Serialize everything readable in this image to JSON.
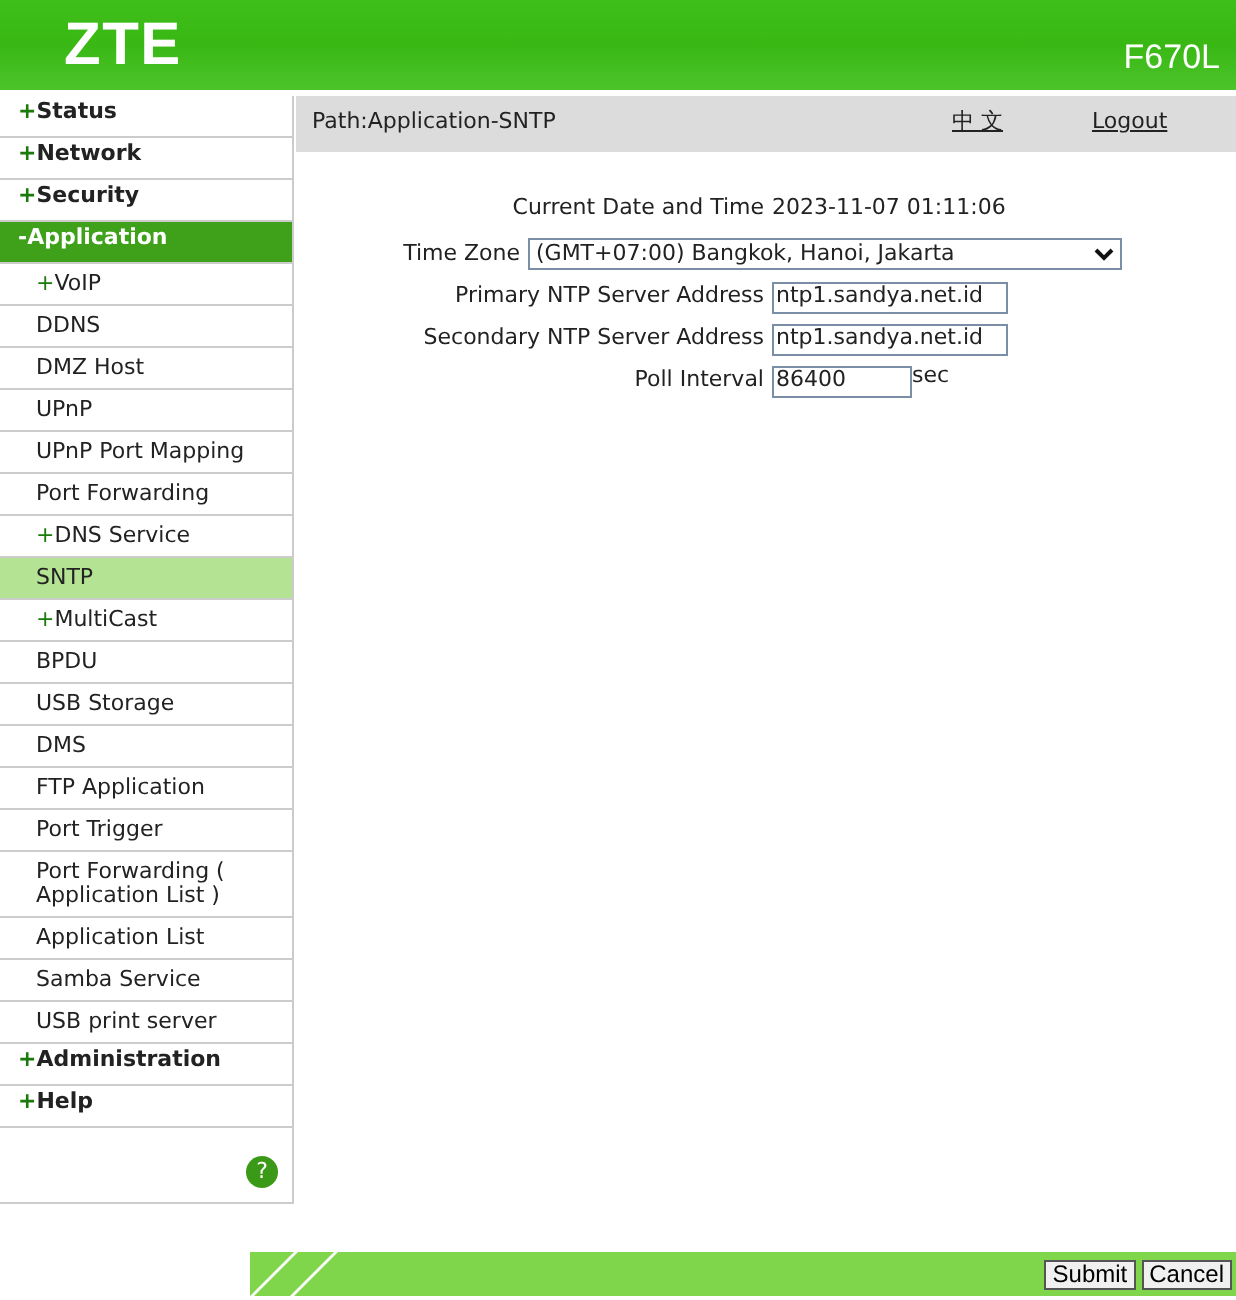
{
  "header": {
    "logo": "ZTE",
    "model": "F670L"
  },
  "sidebar": {
    "items": [
      {
        "marker": "+",
        "label": "Status",
        "selected": false
      },
      {
        "marker": "+",
        "label": "Network",
        "selected": false
      },
      {
        "marker": "+",
        "label": "Security",
        "selected": false
      },
      {
        "marker": "-",
        "label": "Application",
        "selected": true,
        "children": [
          {
            "marker": "+",
            "label": "VoIP",
            "selected": false
          },
          {
            "label": "DDNS",
            "selected": false
          },
          {
            "label": "DMZ Host",
            "selected": false
          },
          {
            "label": "UPnP",
            "selected": false
          },
          {
            "label": "UPnP Port Mapping",
            "selected": false
          },
          {
            "label": "Port Forwarding",
            "selected": false
          },
          {
            "marker": "+",
            "label": "DNS Service",
            "selected": false
          },
          {
            "label": "SNTP",
            "selected": true
          },
          {
            "marker": "+",
            "label": "MultiCast",
            "selected": false
          },
          {
            "label": "BPDU",
            "selected": false
          },
          {
            "label": "USB Storage",
            "selected": false
          },
          {
            "label": "DMS",
            "selected": false
          },
          {
            "label": "FTP Application",
            "selected": false
          },
          {
            "label": "Port Trigger",
            "selected": false
          },
          {
            "label": "Port Forwarding ( Application List )",
            "selected": false
          },
          {
            "label": "Application List",
            "selected": false
          },
          {
            "label": "Samba Service",
            "selected": false
          },
          {
            "label": "USB print server",
            "selected": false
          }
        ]
      },
      {
        "marker": "+",
        "label": "Administration",
        "selected": false
      },
      {
        "marker": "+",
        "label": "Help",
        "selected": false
      }
    ],
    "help": "?"
  },
  "path_bar": {
    "path": "Path:Application-SNTP",
    "language": "中 文",
    "logout": "Logout"
  },
  "form": {
    "current_time": {
      "label": "Current Date and Time",
      "value": "2023-11-07 01:11:06"
    },
    "time_zone": {
      "label": "Time Zone",
      "value": "(GMT+07:00) Bangkok, Hanoi, Jakarta"
    },
    "fields": [
      {
        "label": "Primary NTP Server Address",
        "value": "ntp1.sandya.net.id"
      },
      {
        "label": "Secondary NTP Server Address",
        "value": "ntp1.sandya.net.id"
      },
      {
        "label": "Poll Interval",
        "value": "86400",
        "unit": "sec"
      }
    ]
  },
  "buttons": [
    "Submit",
    "Cancel"
  ]
}
